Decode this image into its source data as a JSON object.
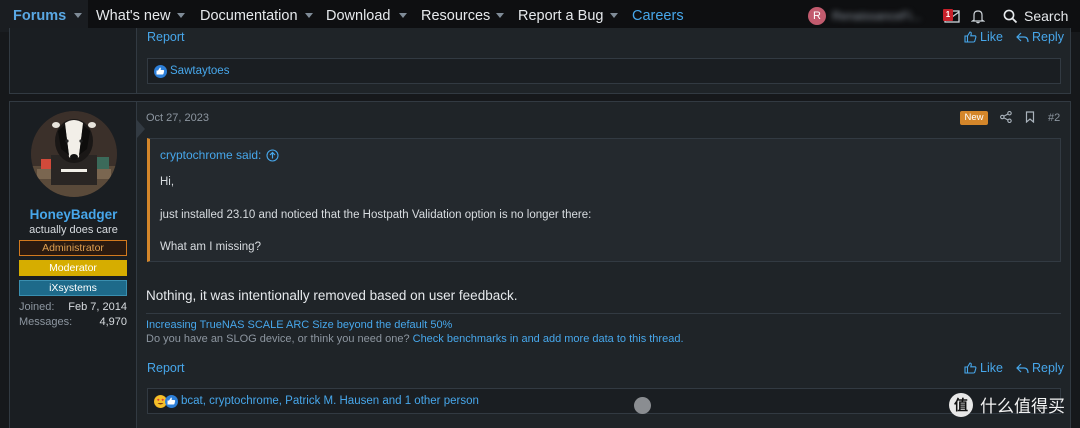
{
  "nav": {
    "items": [
      {
        "label": "Forums"
      },
      {
        "label": "What's new"
      },
      {
        "label": "Documentation"
      },
      {
        "label": "Download"
      },
      {
        "label": "Resources"
      },
      {
        "label": "Report a Bug"
      },
      {
        "label": "Careers"
      }
    ],
    "user_initial": "R",
    "user_name": "RenaissanceFi...",
    "alert_count": "1",
    "search_label": "Search"
  },
  "post1": {
    "report_label": "Report",
    "like_label": "Like",
    "reply_label": "Reply",
    "reactions_text": "Sawtaytoes"
  },
  "post2": {
    "author": {
      "name": "HoneyBadger",
      "title": "actually does care",
      "banners": [
        "Administrator",
        "Moderator",
        "iXsystems"
      ],
      "joined_label": "Joined:",
      "joined_value": "Feb 7, 2014",
      "messages_label": "Messages:",
      "messages_value": "4,970"
    },
    "date": "Oct 27, 2023",
    "new_badge": "New",
    "post_number": "#2",
    "quote": {
      "author_said": "cryptochrome said:",
      "lines": [
        "Hi,",
        "just installed 23.10 and noticed that the Hostpath Validation option is no longer there:",
        "What am I missing?"
      ]
    },
    "body": "Nothing, it was intentionally removed based on user feedback.",
    "signature": {
      "line1": "Increasing TrueNAS SCALE ARC Size beyond the default 50%",
      "line2_prefix": "Do you have an SLOG device, or think you need one?",
      "line2_link": "Check benchmarks in and add more data to this thread."
    },
    "report_label": "Report",
    "like_label": "Like",
    "reply_label": "Reply",
    "reactions_text": "bcat, cryptochrome, Patrick M. Hausen and 1 other person"
  },
  "watermark": {
    "logo_text": "值",
    "text": "什么值得买"
  }
}
